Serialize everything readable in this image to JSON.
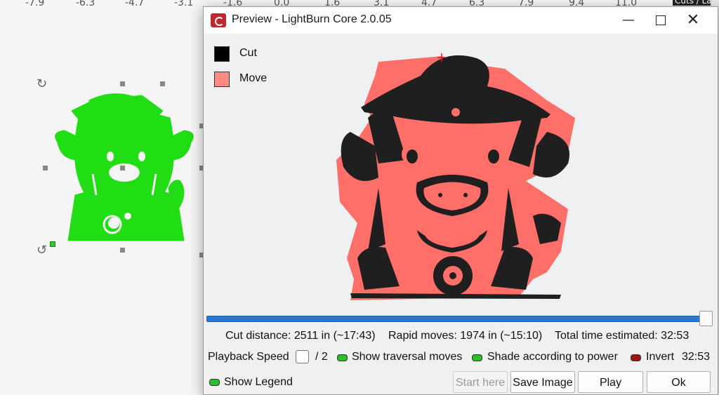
{
  "canvas": {
    "ruler_ticks": [
      "-7.9",
      "-6.3",
      "-4.7",
      "-3.1",
      "-1.6",
      "0.0",
      "1.6",
      "3.1",
      "4.7",
      "6.3",
      "7.9",
      "9.4",
      "11.0"
    ],
    "right_panel_header": "Cuts / La",
    "shape_color": "#21dd14"
  },
  "dialog": {
    "title": "Preview - LightBurn Core 2.0.05",
    "legend": [
      {
        "label": "Cut",
        "color": "#000000"
      },
      {
        "label": "Move",
        "color": "#ff8a85"
      }
    ],
    "playback_progress": 1.0,
    "stats": {
      "cut_distance": "Cut distance: 2511 in (~17:43)",
      "rapid_moves": "Rapid moves: 1974 in (~15:10)",
      "total_time": "Total time estimated: 32:53"
    },
    "controls": {
      "playback_speed_label": "Playback Speed",
      "speed_divisor": "/ 2",
      "show_traversal_label": "Show traversal moves",
      "shade_power_label": "Shade according to power",
      "invert_label": "Invert",
      "elapsed_time": "32:53",
      "show_legend_label": "Show Legend"
    },
    "buttons": {
      "start_here": "Start here",
      "save_image": "Save Image",
      "play": "Play",
      "ok": "Ok"
    },
    "colors": {
      "move": "#ff6f6a",
      "cut": "#1f1f1f",
      "slider": "#2a78d6"
    }
  }
}
